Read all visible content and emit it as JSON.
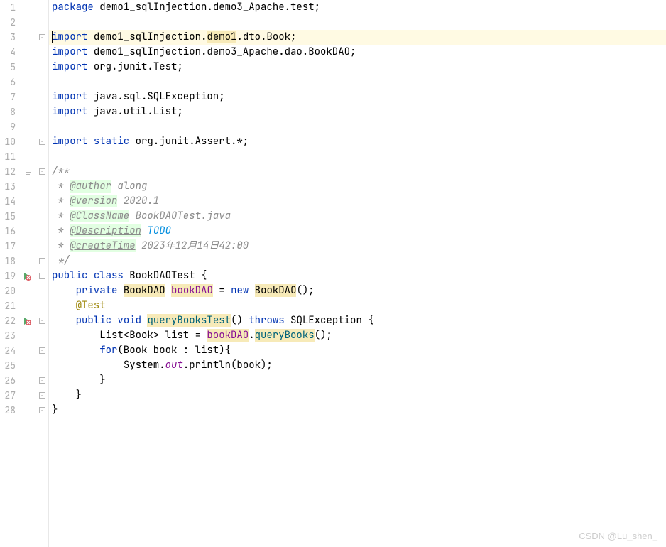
{
  "lines": {
    "1": 1,
    "2": 2,
    "3": 3,
    "4": 4,
    "5": 5,
    "6": 6,
    "7": 7,
    "8": 8,
    "9": 9,
    "10": 10,
    "11": 11,
    "12": 12,
    "13": 13,
    "14": 14,
    "15": 15,
    "16": 16,
    "17": 17,
    "18": 18,
    "19": 19,
    "20": 20,
    "21": 21,
    "22": 22,
    "23": 23,
    "24": 24,
    "25": 25,
    "26": 26,
    "27": 27,
    "28": 28
  },
  "code": {
    "l1_kw": "package",
    "l1_rest": "demo1_sqlInjection.demo3_Apache.test;",
    "l3_kw": "import",
    "l3_p1": "demo1_sqlInjection.",
    "l3_hl": "demo1",
    "l3_p2": ".dto.Book;",
    "l4_kw": "import",
    "l4_rest": "demo1_sqlInjection.demo3_Apache.dao.BookDAO;",
    "l5_kw": "import",
    "l5_p1": "org.junit.",
    "l5_cls": "Test",
    "l5_p2": ";",
    "l7_kw": "import",
    "l7_rest": "java.sql.SQLException;",
    "l8_kw": "import",
    "l8_rest": "java.util.List;",
    "l10_kw": "import static",
    "l10_rest": "org.junit.Assert.*;",
    "l12": "/**",
    "l13_p": " * ",
    "l13_tag": "@author",
    "l13_rest": " along",
    "l14_p": " * ",
    "l14_tag": "@version",
    "l14_rest": " 2020.1",
    "l15_p": " * ",
    "l15_tag": "@ClassName",
    "l15_rest": " BookDAOTest.java",
    "l16_p": " * ",
    "l16_tag": "@Description",
    "l16_rest": " ",
    "l16_todo": "TODO",
    "l17_p": " * ",
    "l17_tag": "@createTime",
    "l17_rest": " 2023年12月14日42:00",
    "l18": " */",
    "l19_kw1": "public",
    "l19_kw2": "class",
    "l19_cls": "BookDAOTest {",
    "l20_kw1": "private",
    "l20_type": "BookDAO",
    "l20_field": "bookDAO",
    "l20_eq": " = ",
    "l20_kw2": "new",
    "l20_ctor": "BookDAO",
    "l20_end": "();",
    "l21_ann": "@Test",
    "l22_kw1": "public",
    "l22_kw2": "void",
    "l22_method": "queryBooksTest",
    "l22_paren": "() ",
    "l22_kw3": "throws",
    "l22_exc": " SQLException {",
    "l23_p1": "List<Book> list = ",
    "l23_field": "bookDAO",
    "l23_dot": ".",
    "l23_method": "queryBooks",
    "l23_end": "();",
    "l24_kw": "for",
    "l24_rest": "(Book book : list){",
    "l25_p1": "System.",
    "l25_out": "out",
    "l25_p2": ".println(book);",
    "l26": "}",
    "l27": "}",
    "l28": "}"
  },
  "watermark": "CSDN @Lu_shen_",
  "fold": {
    "minus": "−"
  }
}
